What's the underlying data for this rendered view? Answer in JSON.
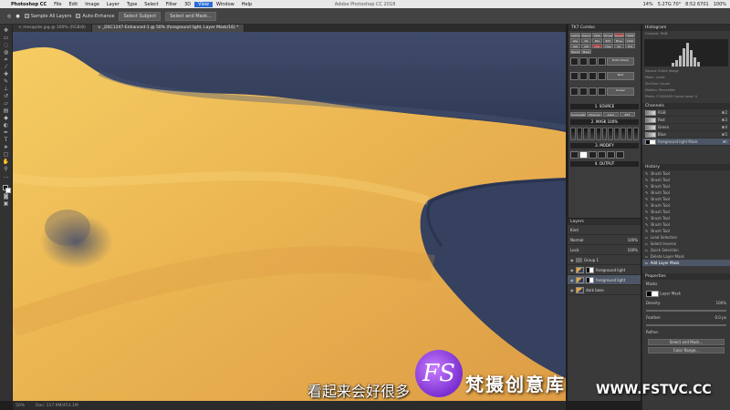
{
  "menubar": {
    "items": [
      "Photoshop CC",
      "File",
      "Edit",
      "Image",
      "Layer",
      "Type",
      "Select",
      "Filter",
      "3D",
      "View",
      "Window",
      "Help"
    ],
    "window_title": "Adobe Photoshop CC 2018",
    "status_right": [
      "14%",
      "5.27G 70°",
      "8:52 6701",
      "100%"
    ]
  },
  "options_bar": {
    "sample_all_layers": "Sample All Layers",
    "auto_enhance": "Auto-Enhance",
    "select_subject": "Select Subject",
    "select_mask": "Select and Mask..."
  },
  "tabs": [
    {
      "label": "× mesquite.jpg @ 100% (RGB/8)",
      "active": false
    },
    {
      "label": "× _DSC1247-Enhanced-1 @ 50% (foreground light, Layer Mask/16) *",
      "active": true
    }
  ],
  "status_bar": {
    "zoom": "50%",
    "doc": "Doc: 117.9M/453.1M"
  },
  "tk_panel": {
    "title": "TK7 Combo",
    "section_source": "1. SOURCE",
    "source_tabs": [
      "Composite",
      "Channel",
      "Color",
      "EXT"
    ],
    "section_mask": "2. MASK",
    "mask_pct": "100%",
    "section_modify": "3. MODIFY",
    "section_output": "4. OUTPUT",
    "buttons": [
      "Lights",
      "Darks",
      "Mids",
      "Zones",
      "Shadow",
      "Hghlt",
      "Lite",
      "Dk",
      "Mid",
      "EXT",
      "Blue",
      "HCR",
      "Sat",
      "AM",
      "Chn",
      "Hue",
      "Clr",
      "Pnt",
      "Stamp",
      "Mask"
    ],
    "luma_label": "Extra Sharp",
    "info_labels": [
      "Mult",
      "Screen",
      "sRGB"
    ]
  },
  "layers_panel": {
    "title": "Layers",
    "filter_label": "Kind",
    "blend_mode": "Normal",
    "opacity": "100%",
    "fill": "100%",
    "lock_label": "Lock:",
    "rows": [
      {
        "name": "Group 1",
        "type": "group",
        "selected": false
      },
      {
        "name": "foreground light",
        "type": "masked",
        "selected": false
      },
      {
        "name": "foreground light",
        "type": "masked",
        "selected": true
      },
      {
        "name": "dark base",
        "type": "image",
        "selected": false
      }
    ]
  },
  "right_column": {
    "histogram_title": "Histogram",
    "channel_label": "Channel:",
    "channel_value": "RGB",
    "source_label": "Source:",
    "source_value": "Entire Image",
    "info_lines": [
      "Mean:     Level:",
      "Std Dev:  Count:",
      "Median:   Percentile:",
      "Pixels: 27429653  Cache Level: 4"
    ],
    "channels_title": "Channels",
    "channels": [
      {
        "name": "RGB",
        "shortcut": "⌘2"
      },
      {
        "name": "Red",
        "shortcut": "⌘3"
      },
      {
        "name": "Green",
        "shortcut": "⌘4"
      },
      {
        "name": "Blue",
        "shortcut": "⌘5"
      },
      {
        "name": "foreground light Mask",
        "shortcut": "⌘\\"
      }
    ],
    "history_title": "History",
    "history": [
      "Brush Tool",
      "Brush Tool",
      "Brush Tool",
      "Brush Tool",
      "Brush Tool",
      "Brush Tool",
      "Brush Tool",
      "Brush Tool",
      "Brush Tool",
      "Brush Tool",
      "Load Selection",
      "Select Inverse",
      "Quick Selection",
      "Delete Layer Mask",
      "Add Layer Mask"
    ],
    "properties_title": "Properties",
    "properties_masks": "Masks",
    "properties_layer_mask": "Layer Mask",
    "density_label": "Density:",
    "density_value": "100%",
    "feather_label": "Feather:",
    "feather_value": "0.0 px",
    "refine_label": "Refine:",
    "select_mask_btn": "Select and Mask...",
    "color_range_btn": "Color Range..."
  },
  "overlay": {
    "subtitle": "看起来会好很多",
    "brand": "梵摄创意库",
    "url": "WWW.FSTVC.CC",
    "logo": "FS"
  },
  "colors": {
    "sand_light": "#f2c45a",
    "sand_mid": "#e5a84a",
    "shadow_blue": "#33405f",
    "panel_bg": "#383838",
    "select_blue": "#2a6cd8"
  }
}
